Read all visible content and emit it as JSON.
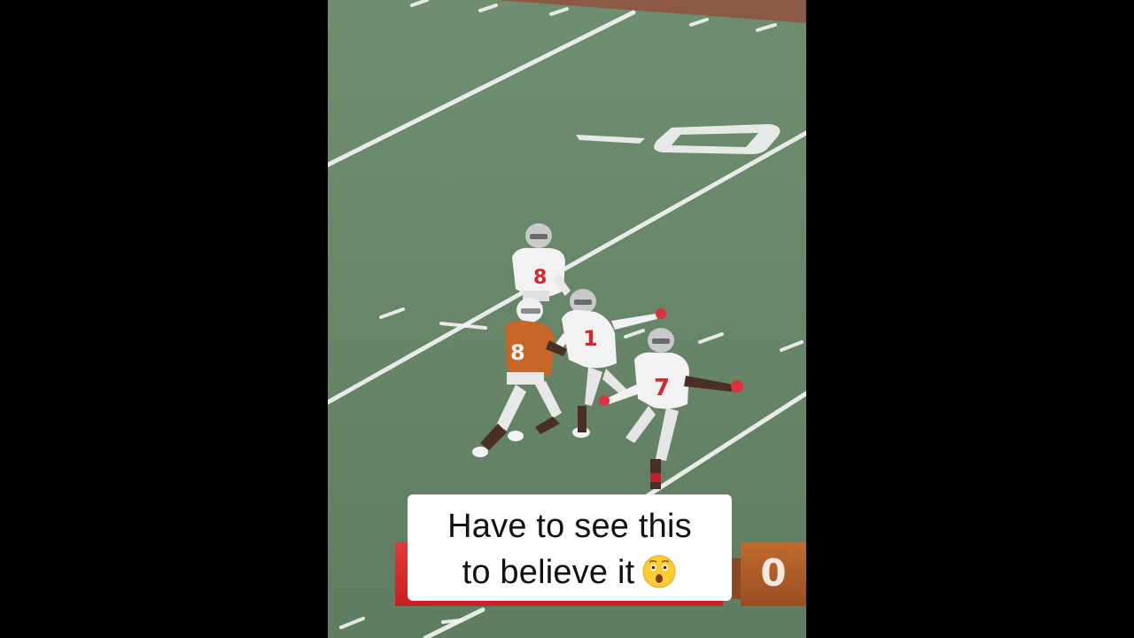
{
  "video": {
    "caption": {
      "line1": "Have to see this",
      "line2": "to believe it",
      "emoji": "astonished-face-icon"
    },
    "scoreboard": {
      "score": "0"
    },
    "field": {
      "yard_marker": "0",
      "players": [
        {
          "team": "white",
          "number": "8"
        },
        {
          "team": "white",
          "number": "1"
        },
        {
          "team": "white",
          "number": "7"
        },
        {
          "team": "orange",
          "number": "8"
        }
      ]
    },
    "colors": {
      "turf": "#6b8a6c",
      "white_jersey": "#f2f2f2",
      "white_jersey_number": "#d8262d",
      "orange_jersey": "#c8662a",
      "scoreboard_red": "#cf1f29",
      "scoreboard_orange": "#b05e2b"
    }
  }
}
